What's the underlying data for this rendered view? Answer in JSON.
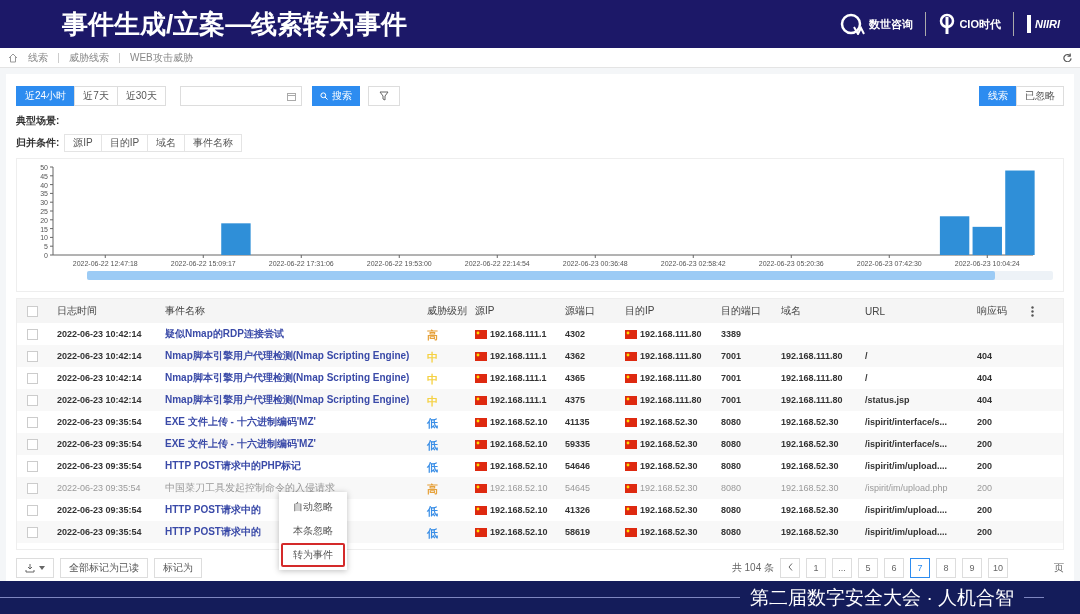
{
  "slide_title": "事件生成/立案—线索转为事件",
  "logos": [
    {
      "kind": "dw",
      "text": "数世咨询"
    },
    {
      "kind": "cio",
      "text": "CIO时代"
    },
    {
      "kind": "niiri",
      "text": "NIIRI"
    }
  ],
  "breadcrumb": [
    "线索",
    "威胁线索",
    "WEB攻击威胁"
  ],
  "time_ranges": [
    {
      "label": "近24小时",
      "selected": true
    },
    {
      "label": "近7天",
      "selected": false
    },
    {
      "label": "近30天",
      "selected": false
    }
  ],
  "search_button": "搜索",
  "view_tabs": [
    {
      "label": "线索",
      "selected": true
    },
    {
      "label": "已忽略",
      "selected": false
    }
  ],
  "scenario_label": "典型场景:",
  "merge_label": "归并条件:",
  "merge_options": [
    "源IP",
    "目的IP",
    "域名",
    "事件名称"
  ],
  "chart_data": {
    "type": "bar",
    "ylim": [
      0,
      50
    ],
    "yticks": [
      0,
      5,
      10,
      15,
      20,
      25,
      30,
      35,
      40,
      45,
      50
    ],
    "categories": [
      "2022-06-22 12:47:18",
      null,
      null,
      "2022-06-22 15:09:17",
      null,
      null,
      "2022-06-22 17:31:06",
      null,
      null,
      "2022-06-22 19:53:00",
      null,
      null,
      "2022-06-22 22:14:54",
      null,
      null,
      "2022-06-23 00:36:48",
      null,
      null,
      "2022-06-23 02:58:42",
      null,
      null,
      "2022-06-23 05:20:36",
      null,
      null,
      "2022-06-23 07:42:30",
      null,
      null,
      "2022-06-23 10:04:24",
      null
    ],
    "values": [
      null,
      null,
      null,
      null,
      18,
      null,
      null,
      null,
      null,
      null,
      null,
      null,
      null,
      null,
      null,
      null,
      null,
      null,
      null,
      null,
      null,
      null,
      null,
      null,
      null,
      null,
      22,
      16,
      48
    ]
  },
  "chart_range": {
    "level": 0.94
  },
  "table": {
    "select_all": false,
    "columns": [
      "日志时间",
      "事件名称",
      "威胁级别",
      "源IP",
      "源端口",
      "目的IP",
      "目的端口",
      "域名",
      "URL",
      "响应码"
    ],
    "rows": [
      {
        "time": "2022-06-23 10:42:14",
        "event": "疑似Nmap的RDP连接尝试",
        "severity": "高",
        "color": "#e6a23c",
        "src_ip": "192.168.111.1",
        "checked": false,
        "src_port": "4302",
        "dst_ip": "192.168.111.80",
        "dst_port": "3389",
        "muted": false
      },
      {
        "time": "2022-06-23 10:42:14",
        "event": "Nmap脚本引擎用户代理检测(Nmap Scripting Engine)",
        "severity": "中",
        "color": "#f5d142",
        "src_ip": "192.168.111.1",
        "checked": false,
        "src_port": "4362",
        "dst_ip": "192.168.111.80",
        "dst_port": "7001",
        "domain": "192.168.111.80",
        "url": "/",
        "code": "404",
        "muted": false
      },
      {
        "time": "2022-06-23 10:42:14",
        "event": "Nmap脚本引擎用户代理检测(Nmap Scripting Engine)",
        "severity": "中",
        "color": "#f5d142",
        "src_ip": "192.168.111.1",
        "checked": false,
        "src_port": "4365",
        "dst_ip": "192.168.111.80",
        "dst_port": "7001",
        "domain": "192.168.111.80",
        "url": "/",
        "code": "404",
        "muted": false
      },
      {
        "time": "2022-06-23 10:42:14",
        "event": "Nmap脚本引擎用户代理检测(Nmap Scripting Engine)",
        "severity": "中",
        "color": "#f5d142",
        "src_ip": "192.168.111.1",
        "checked": false,
        "src_port": "4375",
        "dst_ip": "192.168.111.80",
        "dst_port": "7001",
        "domain": "192.168.111.80",
        "url": "/status.jsp",
        "code": "404",
        "muted": false
      },
      {
        "time": "2022-06-23 09:35:54",
        "event": "EXE 文件上传 - 十六进制编码'MZ'",
        "severity": "低",
        "color": "#3a8ee6",
        "src_ip": "192.168.52.10",
        "checked": false,
        "src_port": "41135",
        "dst_ip": "192.168.52.30",
        "dst_port": "8080",
        "domain": "192.168.52.30",
        "url": "/ispirit/interface/s...",
        "code": "200",
        "muted": false
      },
      {
        "time": "2022-06-23 09:35:54",
        "event": "EXE 文件上传 - 十六进制编码'MZ'",
        "severity": "低",
        "color": "#3a8ee6",
        "src_ip": "192.168.52.10",
        "checked": false,
        "src_port": "59335",
        "dst_ip": "192.168.52.30",
        "dst_port": "8080",
        "domain": "192.168.52.30",
        "url": "/ispirit/interface/s...",
        "code": "200",
        "muted": false
      },
      {
        "time": "2022-06-23 09:35:54",
        "event": "HTTP POST请求中的PHP标记",
        "severity": "低",
        "color": "#3a8ee6",
        "src_ip": "192.168.52.10",
        "checked": false,
        "src_port": "54646",
        "dst_ip": "192.168.52.30",
        "dst_port": "8080",
        "domain": "192.168.52.30",
        "url": "/ispirit/im/upload....",
        "code": "200",
        "muted": false
      },
      {
        "time": "2022-06-23 09:35:54",
        "event": "中国菜刀工具发起控制命令的入侵请求",
        "severity": "高",
        "color": "#e6a23c",
        "src_ip": "192.168.52.10",
        "checked": false,
        "src_port": "54645",
        "dst_ip": "192.168.52.30",
        "dst_port": "8080",
        "domain": "192.168.52.30",
        "url": "/ispirit/im/upload.php",
        "code": "200",
        "muted": true
      },
      {
        "time": "2022-06-23 09:35:54",
        "event": "HTTP POST请求中的",
        "severity": "低",
        "color": "#3a8ee6",
        "src_ip": "192.168.52.10",
        "checked": false,
        "src_port": "41326",
        "dst_ip": "192.168.52.30",
        "dst_port": "8080",
        "domain": "192.168.52.30",
        "url": "/ispirit/im/upload....",
        "code": "200",
        "muted": false
      },
      {
        "time": "2022-06-23 09:35:54",
        "event": "HTTP POST请求中的",
        "severity": "低",
        "color": "#3a8ee6",
        "src_ip": "192.168.52.10",
        "checked": false,
        "src_port": "58619",
        "dst_ip": "192.168.52.30",
        "dst_port": "8080",
        "domain": "192.168.52.30",
        "url": "/ispirit/im/upload....",
        "code": "200",
        "muted": false
      }
    ]
  },
  "context_menu": [
    {
      "label": "自动忽略",
      "selected": false
    },
    {
      "label": "本条忽略",
      "selected": false
    },
    {
      "label": "转为事件",
      "selected": true
    }
  ],
  "footer": {
    "actions": [
      "全部标记为已读",
      "标记为"
    ],
    "total": "共 104 条",
    "pages": [
      {
        "label": "1",
        "selected": false
      },
      {
        "label": "...",
        "selected": false
      },
      {
        "label": "5",
        "selected": false
      },
      {
        "label": "6",
        "selected": false
      },
      {
        "label": "7",
        "selected": true
      },
      {
        "label": "8",
        "selected": false
      },
      {
        "label": "9",
        "selected": false
      },
      {
        "label": "10",
        "selected": false
      }
    ],
    "page_unit": "页"
  },
  "banner": "第二届数字安全大会 · 人机合智"
}
